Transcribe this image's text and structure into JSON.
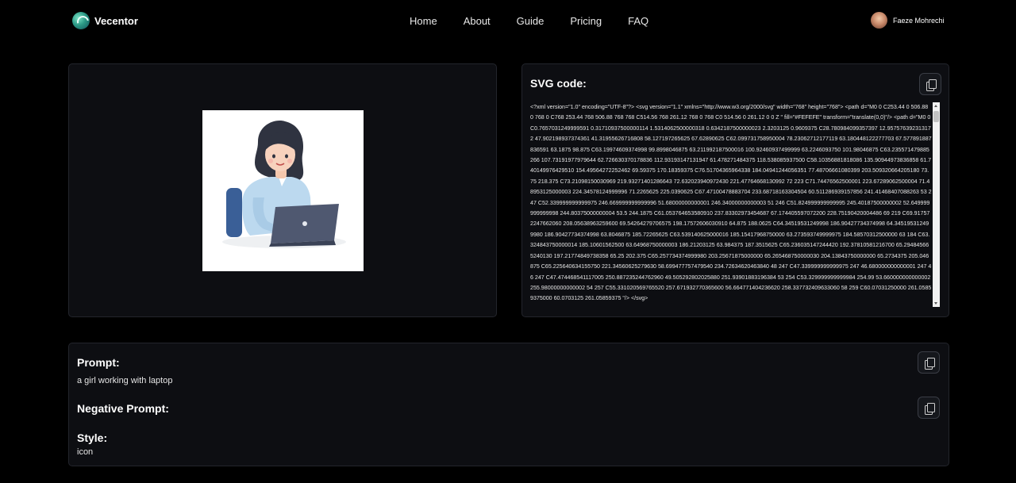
{
  "nav": {
    "brand": "Vecentor",
    "links": [
      "Home",
      "About",
      "Guide",
      "Pricing",
      "FAQ"
    ],
    "user_name": "Faeze Mohrechi"
  },
  "svg_panel": {
    "title": "SVG code:",
    "code": "<?xml version=\"1.0\" encoding=\"UTF-8\"?> <svg version=\"1.1\" xmlns=\"http://www.w3.org/2000/svg\" width=\"768\" height=\"768\"> <path d=\"M0 0 C253.44 0 506.88 0 768 0 C768 253.44 768 506.88 768 768 C514.56 768 261.12 768 0 768 C0 514.56 0 261.12 0 0 Z \" fill=\"#FEFEFE\" transform=\"translate(0,0)\"/> <path d=\"M0 0 C0.7657031249999591 0.31710937500000114 1.5314062500000318 0.6342187500000023 2.3203125 0.9609375 C28.780984099357397 12.957576392313172 47.902198937374361 41.31955626716808 58.127197265625 67.62890625 C62.099731758950004 78.23062712177119 63.180448122277703 67.577891887836591 63.1875 98.875 C63.19974609374998 99.8998046875 63.211992187500016 100.92460937499999 63.2246093750 101.98046875 C63.235571479885266 107.73191977979644 62.726630370178836 112.93193147131947 61.478271484375 118.538085937500 C58.10356881818086 135.90944973836858 61.740149976429510 154.49564272252462 69.59375 170.18359375 C76.51704365964338 184.04941244056351 77.48706661080399 203.509320664205180 73.75 218.375 C73.21098150030969 219.93271401286643 72.632023940972430 221.47764668130992 72 223 C71.74476562500001 223.67289062500004 71.48953125000003 224.34578124999996 71.2265625 225.0390625 C67.47100478883704 233.68718163304504 60.511286939157856 241.41468407088263 53 247 C52.339999999999975 246.669999999999996 51.68000000000001 246.34000000000003 51 246 C51.824999999999995 245.40187500000002 52.649999999999998 244.80375000000004 53.5 244.1875 C61.053764653580910 237.83302973454687 67.174405597072200 228.75190420004486 69 219 C69.917572247662060 208.05638963259600 69.54264279706575 198.17572606030910 64.875 188.0625 C64.34519531249998 186.90427734374998 64.345195312499980 186.90427734374998 63.8046875 185.72265625 C63.539140625000016 185.15417968750000 63.273593749999975 184.58570312500000 63 184 C63.324843750000014 185.10601562500 63.64968750000003 186.21203125 63.984375 187.3515625 C65.236035147244420 192.37810581216700 65.294845665240130 197.21774849738358 65.25 202.375 C65.257734374999980 203.25671875000000 65.265468750000030 204.13843750000000 65.2734375 205.046875 C65.225640634155750 221.34560625279630 58.699477757479540 234.72634620463840 48 247 C47.339999999999975 247 46.680000000000001 247 46 247 C47.474468541117005 250.887235244762960 49.505292802025880 251.93901883196384 53 254 C53.329999999999984 254.99 53.660000000000002 255.98000000000002 54 257 C55.331020569765520 257.671932770365600 56.664771404236620 258.337732409633060 58 259 C60.07031250000 261.05859375000 60.0703125 261.05859375 \"/> </svg>"
  },
  "info": {
    "prompt_label": "Prompt:",
    "prompt_value": "a girl working with laptop",
    "negative_label": "Negative Prompt:",
    "negative_value": "",
    "style_label": "Style:",
    "style_value": "icon"
  },
  "colors": {
    "background": "#000000",
    "panel": "#0d0e12",
    "panel_border": "#23252c",
    "shirt": "#bcd9ef",
    "hair": "#2f3340",
    "laptop": "#4f5870",
    "chair": "#3a5f97"
  },
  "icons": [
    "vecentor-logo-icon",
    "avatar",
    "copy-icon"
  ]
}
